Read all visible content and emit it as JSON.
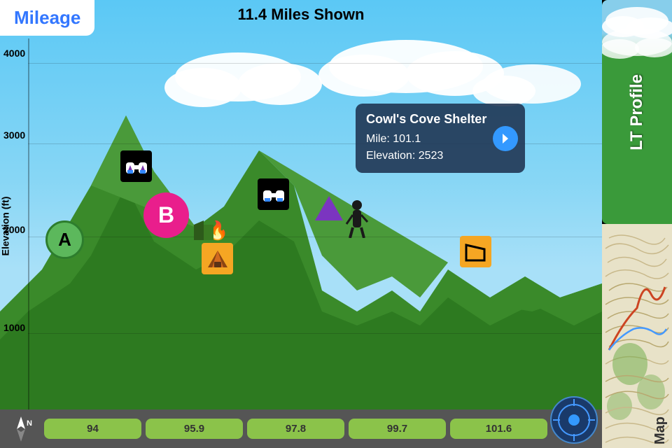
{
  "header": {
    "mileage_label": "Mileage",
    "miles_shown": "11.4 Miles Shown"
  },
  "yaxis": {
    "label": "Elevation (ft)",
    "values": [
      "4000",
      "3000",
      "2000",
      "1000"
    ]
  },
  "xaxis": {
    "mile_markers": [
      "94",
      "95.9",
      "97.8",
      "99.7",
      "101.6"
    ]
  },
  "tooltip": {
    "title": "Cowl's Cove Shelter",
    "mile_label": "Mile: 101.1",
    "elevation_label": "Elevation: 2523"
  },
  "right_panel": {
    "lt_profile_label": "LT Profile",
    "map_label": "Map"
  },
  "icons": {
    "compass_label": "N",
    "gps_icon": "⊕"
  }
}
